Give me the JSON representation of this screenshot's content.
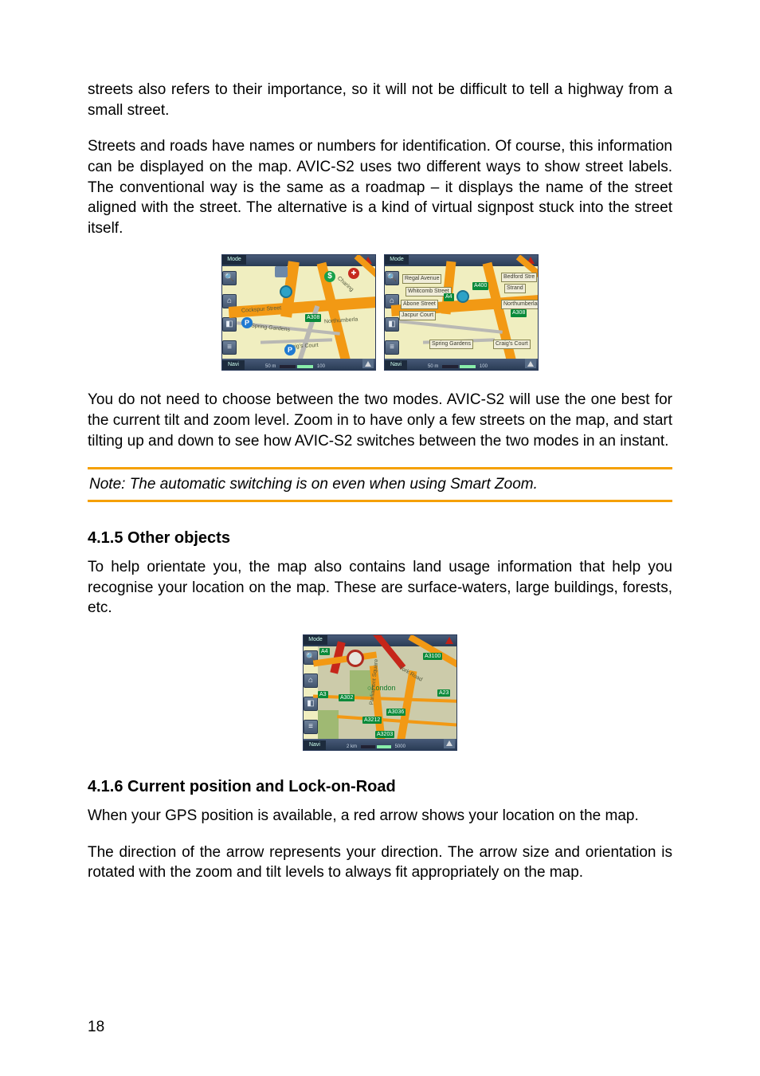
{
  "paragraphs": {
    "p1": "streets also refers to their importance, so it will not be difficult to tell a highway from a small street.",
    "p2": "Streets and roads have names or numbers for identification. Of course, this information can be displayed on the map. AVIC-S2 uses two different ways to show street labels. The conventional way is the same as a roadmap – it displays the name of the street aligned with the street. The alternative is a kind of virtual signpost stuck into the street itself.",
    "p3": "You do not need to choose between the two modes. AVIC-S2 will use the one best for the current tilt and zoom level. Zoom in to have only a few streets on the map, and start tilting up and down to see how AVIC-S2 switches between the two modes in an instant.",
    "p4": "To help orientate you, the map also contains land usage information that help you recognise your location on the map. These are surface-waters, large buildings, forests, etc.",
    "p5": "When your GPS position is available, a red arrow  shows your location on the map.",
    "p6": "The direction of the arrow represents your direction. The arrow size and orientation is rotated with the zoom and tilt levels to always fit appropriately on the map."
  },
  "note": "Note: The automatic switching is on even when using Smart Zoom.",
  "headings": {
    "h1": "4.1.5  Other objects",
    "h2": "4.1.6  Current position and Lock-on-Road"
  },
  "page_number": "18",
  "map_common": {
    "mode_label": "Mode",
    "nav_label": "Navi",
    "p_symbol": "P",
    "dollar": "$"
  },
  "map_a": {
    "scale_left": "50 m",
    "scale_right": "100 ft",
    "road_shield": "A308",
    "street1": "Cockspur Street",
    "street2": "Spring Gardens",
    "street3": "Northumberla",
    "street4": "Craig's Court",
    "street5": "Charing"
  },
  "map_b": {
    "scale_left": "50 m",
    "scale_right": "100 ft",
    "road_shield1": "A400",
    "road_shield2": "A308",
    "label1": "Regal Avenue",
    "label2": "Whitcomb Street",
    "label3": "Abone Street",
    "label4": "Jacpur Court",
    "label5": "Spring Gardens",
    "label6": "Craig's Court",
    "label7": "Bedford Stre",
    "label8": "Strand",
    "label9": "Northumberlan",
    "label10": "A4"
  },
  "map_c": {
    "scale_left": "2 km",
    "scale_right": "5000 ft",
    "city": "London",
    "sh1": "A3212",
    "sh2": "A3036",
    "sh3": "A3203",
    "sh4": "A3100",
    "sh5": "A23",
    "sh6": "A302",
    "sh7": "A4",
    "sh8": "A3",
    "label_york": "York Road",
    "label_parl": "Parliament Square"
  }
}
